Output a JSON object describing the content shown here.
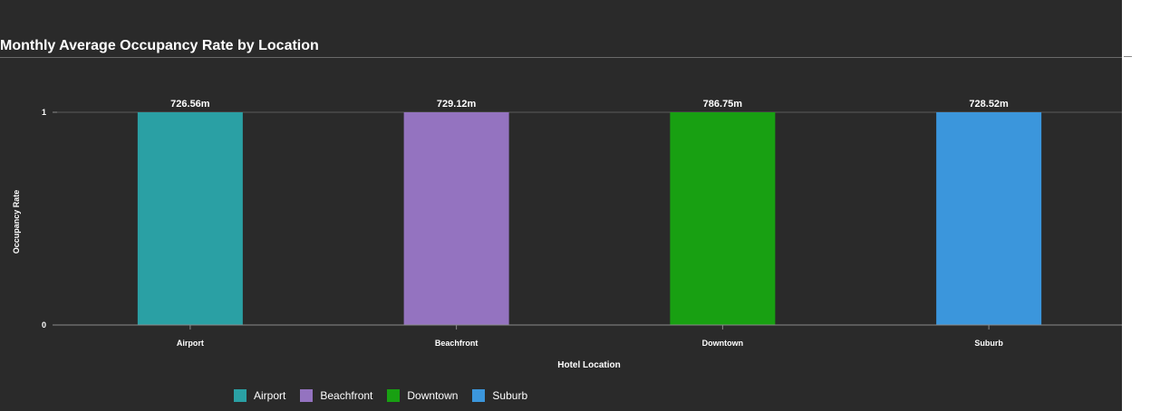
{
  "colors": {
    "background": "#2a2a2a",
    "text": "#ffffff",
    "axis": "#8a8a8a",
    "gridline": "#5a5a5a"
  },
  "chart_data": {
    "type": "bar",
    "title": "Monthly Average Occupancy Rate by Location",
    "xlabel": "Hotel Location",
    "ylabel": "Occupancy Rate",
    "categories": [
      "Airport",
      "Beachfront",
      "Downtown",
      "Suburb"
    ],
    "values": [
      1,
      1,
      1,
      1
    ],
    "data_labels": [
      "726.56m",
      "729.12m",
      "786.75m",
      "728.52m"
    ],
    "colors": [
      "#2aa0a4",
      "#9473c0",
      "#18a012",
      "#3b96dc"
    ],
    "ylim": [
      0,
      1
    ],
    "yticks": [
      "0",
      "1"
    ],
    "grid": true,
    "legend": {
      "position": "bottom",
      "entries": [
        "Airport",
        "Beachfront",
        "Downtown",
        "Suburb"
      ]
    }
  }
}
